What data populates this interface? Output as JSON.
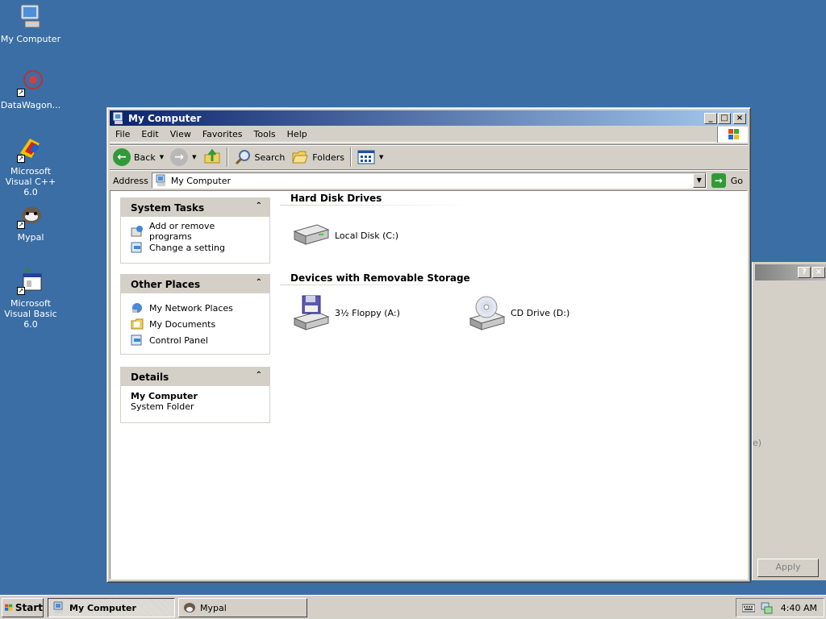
{
  "desktop": {
    "icons": [
      {
        "label": "My Computer"
      },
      {
        "label": "DataWagon..."
      },
      {
        "label": "Microsoft Visual C++ 6.0"
      },
      {
        "label": "Mypal"
      },
      {
        "label": "Microsoft Visual Basic 6.0"
      }
    ]
  },
  "background_dialog": {
    "help_btn": "?",
    "close_btn": "×",
    "apply_label": "Apply",
    "fragment": "e)"
  },
  "window": {
    "title": "My Computer",
    "buttons": {
      "minimize": "_",
      "maximize": "□",
      "close": "×"
    },
    "menu": [
      "File",
      "Edit",
      "View",
      "Favorites",
      "Tools",
      "Help"
    ],
    "toolbar": {
      "back": "Back",
      "search": "Search",
      "folders": "Folders"
    },
    "address": {
      "label": "Address",
      "value": "My Computer",
      "go": "Go"
    },
    "panes": {
      "system_tasks": {
        "title": "System Tasks",
        "items": [
          "Add or remove programs",
          "Change a setting"
        ]
      },
      "other_places": {
        "title": "Other Places",
        "items": [
          "My Network Places",
          "My Documents",
          "Control Panel"
        ]
      },
      "details": {
        "title": "Details",
        "name": "My Computer",
        "type": "System Folder"
      }
    },
    "groups": {
      "hard_disks": {
        "title": "Hard Disk Drives",
        "items": [
          "Local Disk (C:)"
        ]
      },
      "removable": {
        "title": "Devices with Removable Storage",
        "items": [
          "3½ Floppy (A:)",
          "CD Drive (D:)"
        ]
      }
    }
  },
  "taskbar": {
    "start": "Start",
    "tasks": [
      "My Computer",
      "Mypal"
    ],
    "clock": "4:40 AM"
  }
}
